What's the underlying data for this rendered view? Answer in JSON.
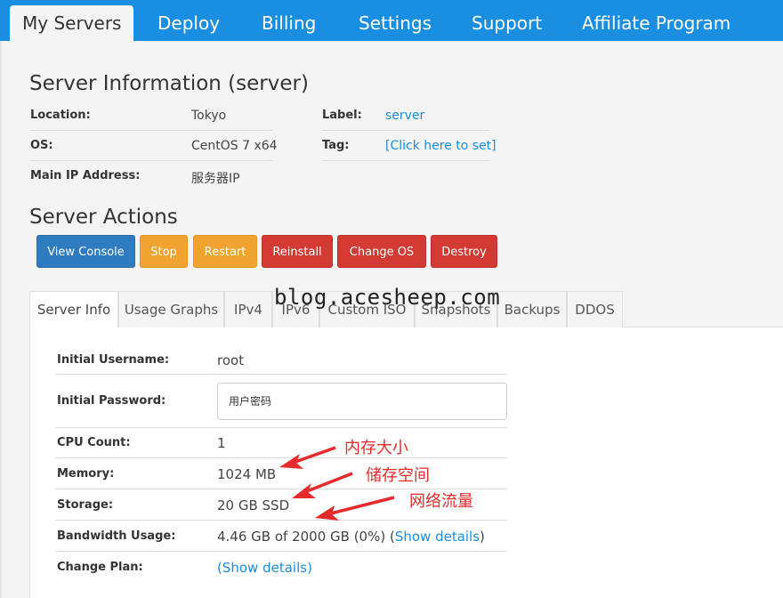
{
  "nav": {
    "tabs": [
      "My Servers",
      "Deploy",
      "Billing",
      "Settings",
      "Support",
      "Affiliate Program"
    ]
  },
  "server_info": {
    "title": "Server Information (server)",
    "location_label": "Location:",
    "location_value": "Tokyo",
    "os_label": "OS:",
    "os_value": "CentOS 7 x64",
    "ip_label": "Main IP Address:",
    "ip_value": "服务器IP",
    "label_label": "Label:",
    "label_value": "server",
    "tag_label": "Tag:",
    "tag_value": "[Click here to set]"
  },
  "actions": {
    "title": "Server Actions",
    "buttons": [
      "View Console",
      "Stop",
      "Restart",
      "Reinstall",
      "Change OS",
      "Destroy"
    ]
  },
  "panel_tabs": [
    "Server Info",
    "Usage Graphs",
    "IPv4",
    "IPv6",
    "Custom ISO",
    "Snapshots",
    "Backups",
    "DDOS"
  ],
  "details": {
    "username_label": "Initial Username:",
    "username_value": "root",
    "password_label": "Initial Password:",
    "password_value": "用户密码",
    "cpu_label": "CPU Count:",
    "cpu_value": "1",
    "memory_label": "Memory:",
    "memory_value": "1024 MB",
    "storage_label": "Storage:",
    "storage_value": "20 GB SSD",
    "bandwidth_label": "Bandwidth Usage:",
    "bandwidth_value": "4.46 GB of 2000 GB (0%) (",
    "bandwidth_link": "Show details",
    "bandwidth_close": ")",
    "plan_label": "Change Plan:",
    "plan_link": "(Show details)"
  },
  "overlay": {
    "watermark": "blog.acesheep.com",
    "anno_memory": "内存大小",
    "anno_storage": "储存空间",
    "anno_bandwidth": "网络流量",
    "arrow_color": "#e52b2b"
  }
}
